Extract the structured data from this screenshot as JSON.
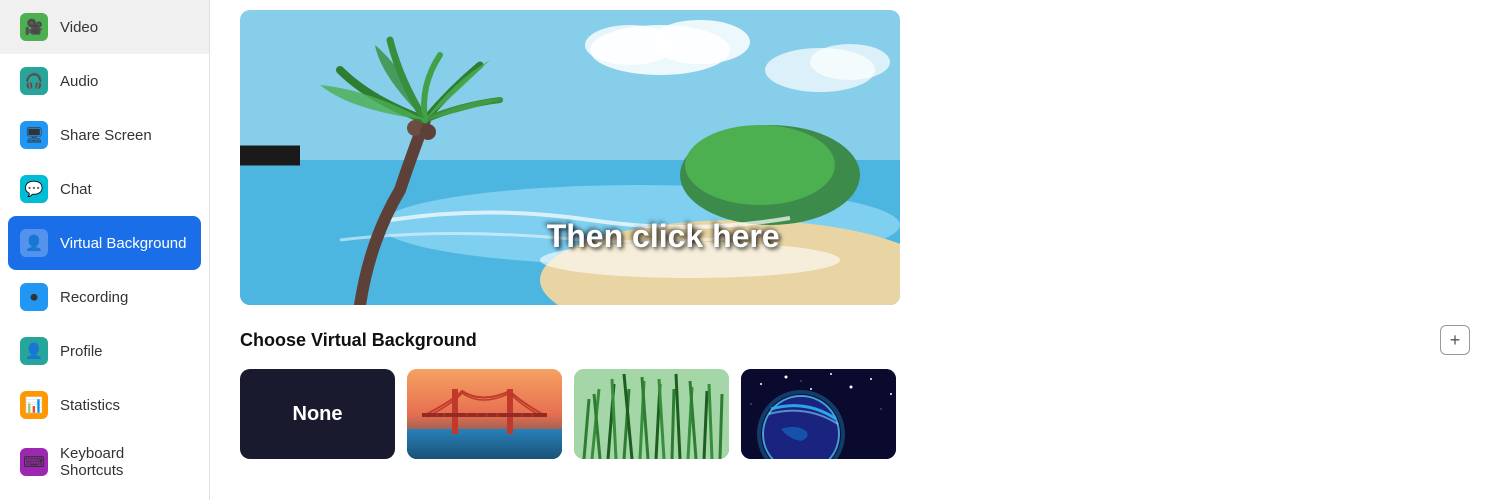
{
  "sidebar": {
    "items": [
      {
        "id": "video",
        "label": "Video",
        "icon": "🎥",
        "iconClass": "icon-green",
        "active": false
      },
      {
        "id": "audio",
        "label": "Audio",
        "icon": "🎧",
        "iconClass": "icon-teal",
        "active": false
      },
      {
        "id": "share-screen",
        "label": "Share Screen",
        "icon": "🖥",
        "iconClass": "icon-blue",
        "active": false
      },
      {
        "id": "chat",
        "label": "Chat",
        "icon": "💬",
        "iconClass": "icon-cyan",
        "active": false
      },
      {
        "id": "virtual-background",
        "label": "Virtual Background",
        "icon": "👤",
        "iconClass": "icon-indigo",
        "active": true
      },
      {
        "id": "recording",
        "label": "Recording",
        "icon": "⏺",
        "iconClass": "icon-blue",
        "active": false
      },
      {
        "id": "profile",
        "label": "Profile",
        "icon": "👤",
        "iconClass": "icon-teal",
        "active": false
      },
      {
        "id": "statistics",
        "label": "Statistics",
        "icon": "📊",
        "iconClass": "icon-orange",
        "active": false
      },
      {
        "id": "keyboard-shortcuts",
        "label": "Keyboard Shortcuts",
        "icon": "⌨",
        "iconClass": "icon-purple",
        "active": false
      }
    ]
  },
  "main": {
    "preview_arrow_text": "Then click here",
    "choose_title": "Choose Virtual Background",
    "add_button_label": "+",
    "thumbnails": [
      {
        "id": "none",
        "label": "None",
        "type": "none"
      },
      {
        "id": "golden",
        "label": "",
        "type": "golden"
      },
      {
        "id": "green",
        "label": "",
        "type": "green"
      },
      {
        "id": "space",
        "label": "",
        "type": "space"
      }
    ]
  }
}
